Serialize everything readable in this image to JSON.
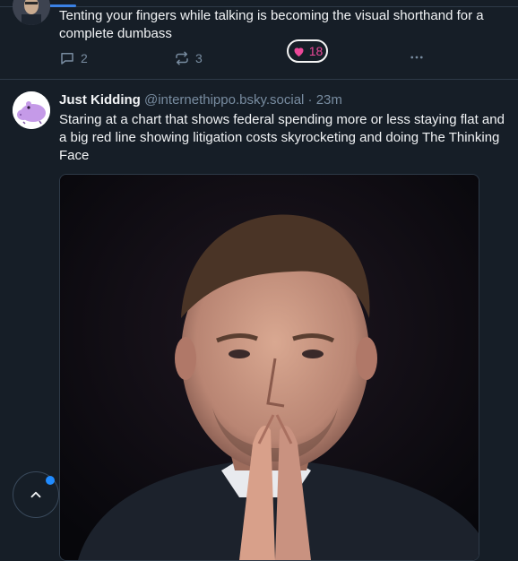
{
  "posts": [
    {
      "text": "Tenting your fingers while talking is becoming the visual shorthand for a complete dumbass",
      "replies": "2",
      "reposts": "3",
      "likes": "18",
      "liked": true
    },
    {
      "author": "Just Kidding",
      "handle": "@internethippo.bsky.social",
      "separator": "·",
      "time": "23m",
      "text": "Staring at a chart that shows federal spending more or less staying flat and a big red line showing litigation costs skyrocketing and doing The Thinking Face"
    }
  ],
  "colors": {
    "background": "#161e27",
    "accent": "#208bfe",
    "like": "#ec4899",
    "muted": "#788ca0"
  },
  "icons": [
    "reply-icon",
    "repost-icon",
    "heart-icon",
    "more-icon",
    "hippo-avatar",
    "chevron-up-icon"
  ]
}
